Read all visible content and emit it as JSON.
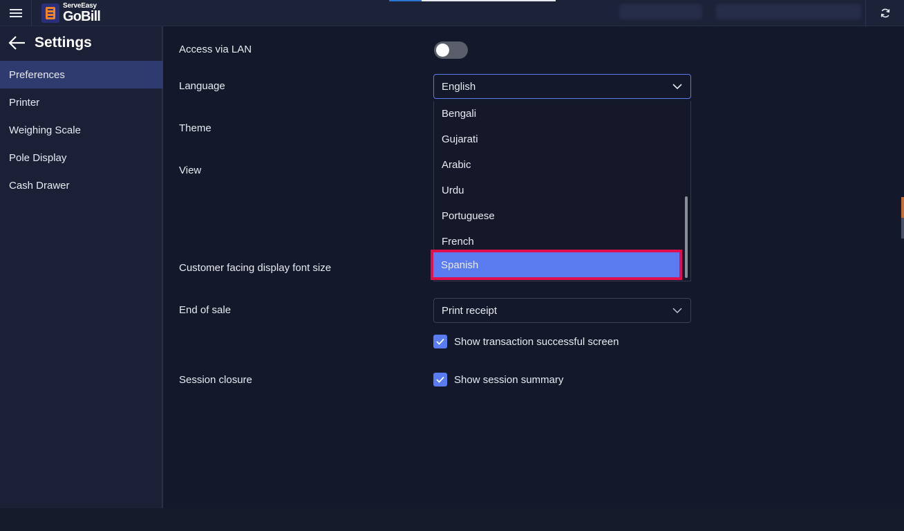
{
  "app": {
    "logo_small": "ServeEasy",
    "logo_big": "GoBill"
  },
  "icons": {
    "menu": "hamburger-icon",
    "refresh": "refresh-icon",
    "back": "back-arrow-icon",
    "chevron": "chevron-down-icon",
    "check": "checkmark-icon"
  },
  "colors": {
    "accent": "#5b7cf0",
    "highlight": "#e0104e",
    "active_nav": "#2f3a6e"
  },
  "sidebar": {
    "title": "Settings",
    "items": [
      {
        "label": "Preferences",
        "active": true
      },
      {
        "label": "Printer"
      },
      {
        "label": "Weighing Scale"
      },
      {
        "label": "Pole Display"
      },
      {
        "label": "Cash Drawer"
      }
    ]
  },
  "settings": {
    "access_lan": {
      "label": "Access via LAN",
      "enabled": false
    },
    "language": {
      "label": "Language",
      "value": "English",
      "options": [
        "Bengali",
        "Gujarati",
        "Arabic",
        "Urdu",
        "Portuguese",
        "French",
        "Spanish"
      ],
      "selected_option": "Spanish"
    },
    "theme": {
      "label": "Theme"
    },
    "view": {
      "label": "View"
    },
    "customer_font": {
      "label": "Customer facing display font size"
    },
    "end_of_sale": {
      "label": "End of sale",
      "value": "Print receipt"
    },
    "show_txn": {
      "label": "Show transaction successful screen",
      "checked": true
    },
    "session_closure": {
      "label": "Session closure"
    },
    "show_summary": {
      "label": "Show session summary",
      "checked": true
    }
  }
}
